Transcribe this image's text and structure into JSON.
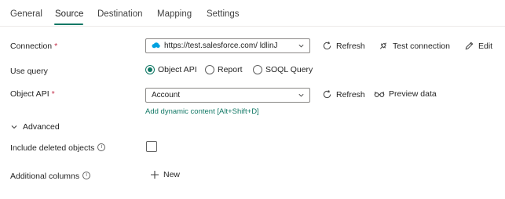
{
  "tabs": [
    {
      "label": "General",
      "active": false
    },
    {
      "label": "Source",
      "active": true
    },
    {
      "label": "Destination",
      "active": false
    },
    {
      "label": "Mapping",
      "active": false
    },
    {
      "label": "Settings",
      "active": false
    }
  ],
  "connection": {
    "label": "Connection",
    "required_mark": "*",
    "value": "https://test.salesforce.com/ ldlinJ",
    "refresh_label": "Refresh",
    "test_label": "Test connection",
    "edit_label": "Edit"
  },
  "use_query": {
    "label": "Use query",
    "options": [
      "Object API",
      "Report",
      "SOQL Query"
    ],
    "selected": "Object API"
  },
  "object_api": {
    "label": "Object API",
    "required_mark": "*",
    "value": "Account",
    "refresh_label": "Refresh",
    "preview_label": "Preview data",
    "dynamic_link": "Add dynamic content [Alt+Shift+D]"
  },
  "advanced": {
    "label": "Advanced",
    "expanded": true
  },
  "include_deleted": {
    "label": "Include deleted objects",
    "info_icon": "i",
    "checked": false
  },
  "additional_columns": {
    "label": "Additional columns",
    "info_icon": "i",
    "new_label": "New"
  },
  "colors": {
    "accent": "#117865",
    "required": "#c4314b",
    "salesforce": "#00a1e0"
  }
}
